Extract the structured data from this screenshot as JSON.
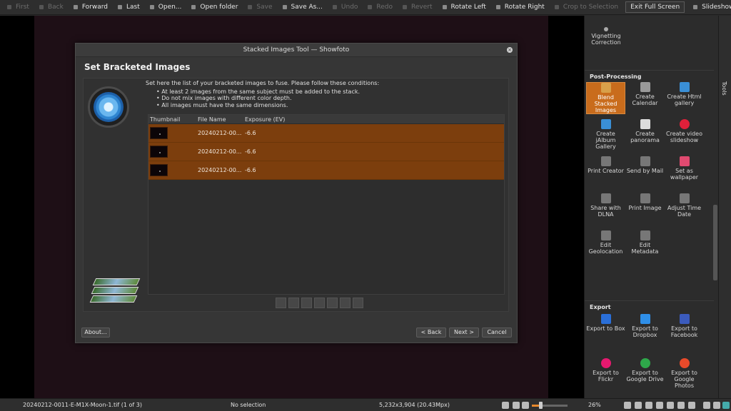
{
  "toolbar": {
    "first": "First",
    "back": "Back",
    "forward": "Forward",
    "last": "Last",
    "open": "Open...",
    "open_folder": "Open folder",
    "save": "Save",
    "save_as": "Save As...",
    "undo": "Undo",
    "redo": "Redo",
    "revert": "Revert",
    "rotate_left": "Rotate Left",
    "rotate_right": "Rotate Right",
    "crop": "Crop to Selection",
    "exit_full_screen": "Exit Full Screen",
    "slideshow": "Slideshow"
  },
  "dialog": {
    "title": "Stacked Images Tool — Showfoto",
    "heading": "Set Bracketed Images",
    "intro": "Set here the list of your bracketed images to fuse. Please follow these conditions:",
    "conditions": [
      "• At least 2 images from the same subject must be added to the stack.",
      "• Do not mix images with different color depth.",
      "• All images must have the same dimensions."
    ],
    "columns": {
      "thumbnail": "Thumbnail",
      "file_name": "File Name",
      "exposure": "Exposure (EV)"
    },
    "rows": [
      {
        "file_name": "20240212-00...",
        "exposure": "-6.6"
      },
      {
        "file_name": "20240212-00...",
        "exposure": "-6.6"
      },
      {
        "file_name": "20240212-00...",
        "exposure": "-6.6"
      }
    ],
    "buttons": {
      "about": "About...",
      "back": "< Back",
      "next": "Next >",
      "cancel": "Cancel"
    }
  },
  "panel": {
    "tabs_label": "Tools",
    "vignetting": "Vignetting Correction",
    "post_processing": {
      "header": "Post-Processing",
      "tools": [
        {
          "label": "Blend Stacked Images",
          "icon": "stack-icon",
          "color": "#d8a04a"
        },
        {
          "label": "Create Calendar",
          "icon": "calendar-icon",
          "color": "#9a9a9a"
        },
        {
          "label": "Create Html gallery",
          "icon": "globe-icon",
          "color": "#3a8fd6"
        },
        {
          "label": "Create jAlbum Gallery",
          "icon": "globe-icon",
          "color": "#3a8fd6"
        },
        {
          "label": "Create panorama",
          "icon": "panorama-icon",
          "color": "#dddddd"
        },
        {
          "label": "Create video slideshow",
          "icon": "record-icon",
          "color": "#e0203a"
        },
        {
          "label": "Print Creator",
          "icon": "printer-icon",
          "color": "#777777"
        },
        {
          "label": "Send by Mail",
          "icon": "mail-icon",
          "color": "#777777"
        },
        {
          "label": "Set as wallpaper",
          "icon": "wallpaper-icon",
          "color": "#e04a70"
        },
        {
          "label": "Share with DLNA",
          "icon": "share-icon",
          "color": "#777777"
        },
        {
          "label": "Print Image",
          "icon": "printer-icon",
          "color": "#777777"
        },
        {
          "label": "Adjust Time Date",
          "icon": "clock-icon",
          "color": "#777777"
        },
        {
          "label": "Edit Geolocation",
          "icon": "map-pin-icon",
          "color": "#777777"
        },
        {
          "label": "Edit Metadata",
          "icon": "tag-icon",
          "color": "#777777"
        }
      ]
    },
    "export": {
      "header": "Export",
      "tools": [
        {
          "label": "Export to Box",
          "icon": "box-icon",
          "color": "#2a6fd8"
        },
        {
          "label": "Export to Dropbox",
          "icon": "dropbox-icon",
          "color": "#2f8fe8"
        },
        {
          "label": "Export to Facebook",
          "icon": "facebook-icon",
          "color": "#3b5bbd"
        },
        {
          "label": "Export to Flickr",
          "icon": "flickr-icon",
          "color": "#e6196f"
        },
        {
          "label": "Export to Google Drive",
          "icon": "google-drive-icon",
          "color": "#2ea84a"
        },
        {
          "label": "Export to Google Photos",
          "icon": "google-photos-icon",
          "color": "#e84a2a"
        }
      ]
    }
  },
  "status": {
    "file": "20240212-0011-E-M1X-Moon-1.tif (1 of 3)",
    "selection": "No selection",
    "dimensions": "5,232x3,904 (20.43Mpx)",
    "zoom": "26%"
  }
}
